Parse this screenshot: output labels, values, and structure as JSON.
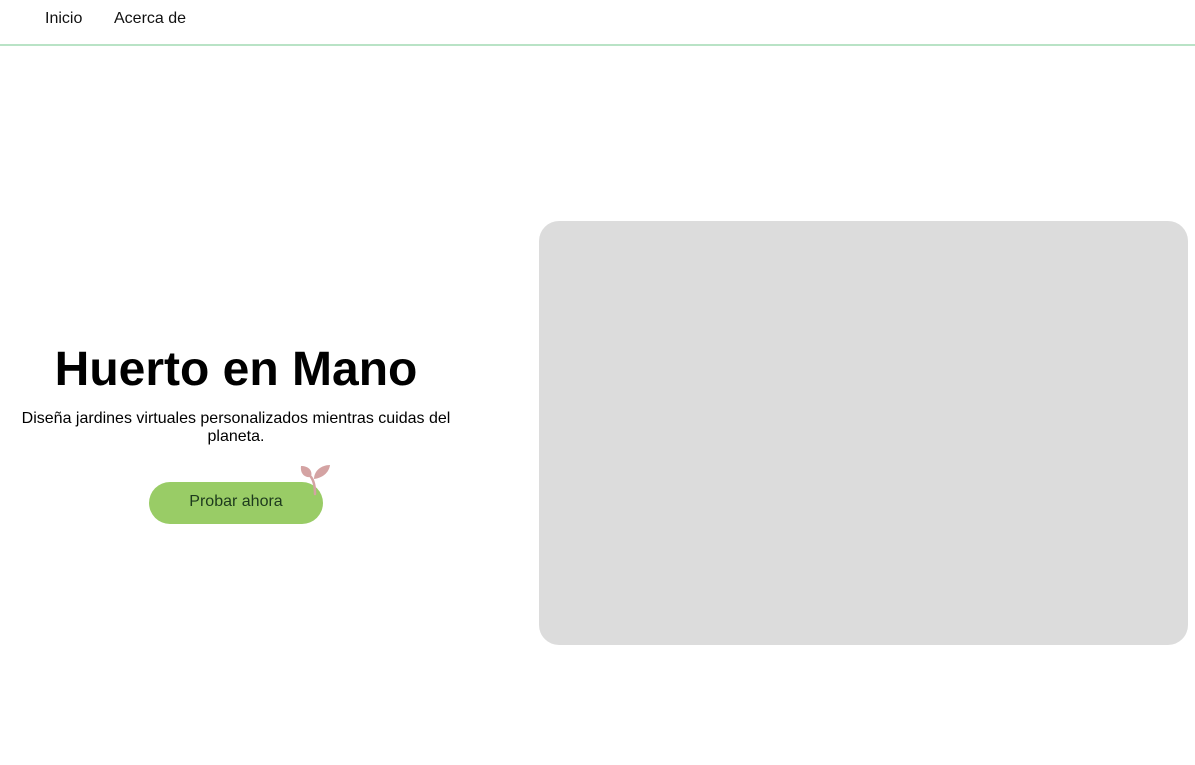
{
  "nav": {
    "items": [
      {
        "label": "Inicio"
      },
      {
        "label": "Acerca de"
      }
    ],
    "border_color": "#b9e3c6"
  },
  "hero": {
    "title": "Huerto en Mano",
    "subtitle": "Diseña jardines virtuales personalizados mientras cuidas del planeta.",
    "cta_label": "Probar ahora",
    "cta_color": "#99cc66",
    "decoration_icon": "sprout-icon",
    "decoration_color": "#d4a3a3"
  },
  "media": {
    "placeholder_color": "#dcdcdc"
  }
}
